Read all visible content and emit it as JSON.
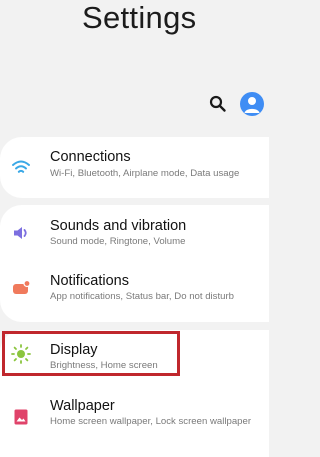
{
  "header": {
    "title": "Settings"
  },
  "icons": {
    "search": "search-icon",
    "account": "account-icon"
  },
  "colors": {
    "accent": "#3f8df4",
    "highlight": "#c0272d"
  },
  "items": [
    {
      "title": "Connections",
      "subtitle": "Wi-Fi, Bluetooth, Airplane mode, Data usage",
      "icon": "wifi-icon",
      "icon_color": "#3aa8e6"
    },
    {
      "title": "Sounds and vibration",
      "subtitle": "Sound mode, Ringtone, Volume",
      "icon": "volume-icon",
      "icon_color": "#7c6fe0"
    },
    {
      "title": "Notifications",
      "subtitle": "App notifications, Status bar, Do not disturb",
      "icon": "notifications-icon",
      "icon_color": "#f07a5c"
    },
    {
      "title": "Display",
      "subtitle": "Brightness, Home screen",
      "icon": "brightness-icon",
      "icon_color": "#8bc53f"
    },
    {
      "title": "Wallpaper",
      "subtitle": "Home screen wallpaper, Lock screen wallpaper",
      "icon": "wallpaper-icon",
      "icon_color": "#e0436a"
    }
  ]
}
